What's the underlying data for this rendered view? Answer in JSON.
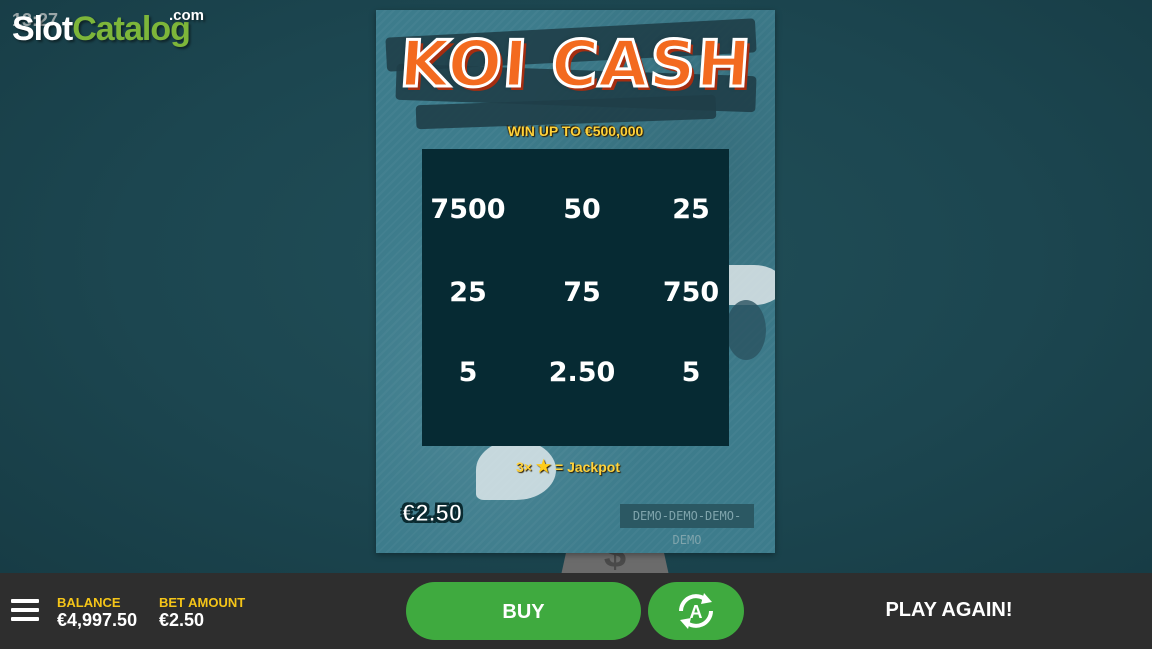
{
  "header": {
    "clock": "13:27",
    "logo": {
      "part1": "Slot",
      "part2": "Catalog",
      "suffix": ".com"
    }
  },
  "ticket": {
    "title": "KOI CASH",
    "subtitle": "WIN UP TO €500,000",
    "grid": [
      [
        "7500",
        "50",
        "25"
      ],
      [
        "25",
        "75",
        "750"
      ],
      [
        "5",
        "2.50",
        "5"
      ]
    ],
    "jackpot": {
      "prefix": "3×",
      "suffix": "= Jackpot",
      "icon": "star-icon"
    },
    "price": "€2.50",
    "demo_label": "DEMO-DEMO-DEMO-DEMO",
    "scratch_tool_symbol": "$"
  },
  "bottombar": {
    "balance_label": "BALANCE",
    "balance_value": "€4,997.50",
    "bet_label": "BET AMOUNT",
    "bet_value": "€2.50",
    "buy_label": "BUY",
    "autoplay_icon": "autoplay-icon",
    "play_again_label": "PLAY AGAIN!"
  },
  "colors": {
    "background": "#1c4750",
    "ticket": "#3d7c8c",
    "grid": "#062a33",
    "accent_green": "#3faa3f",
    "label_yellow": "#f5c518",
    "title_orange": "#f36a1f",
    "bar": "#2e2e2e"
  }
}
